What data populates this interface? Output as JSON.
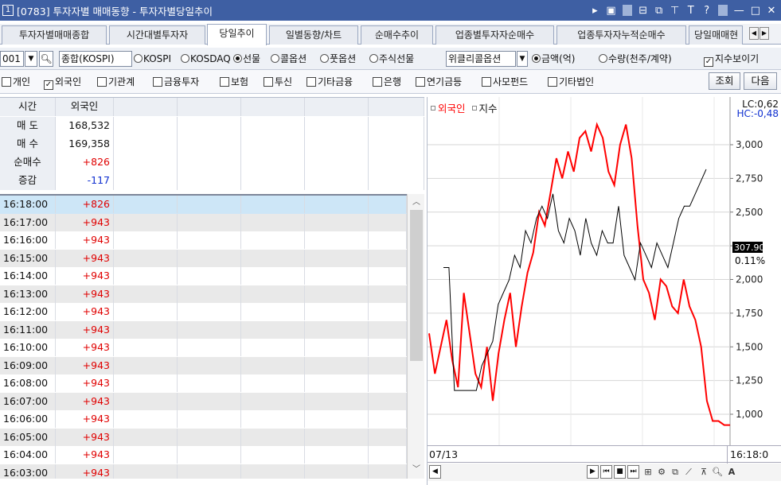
{
  "window": {
    "number": "1",
    "title": "[0783] 투자자별 매매동향 - 투자자별당일추이",
    "controls": [
      "▸",
      "▣",
      "⊟",
      "⧉",
      "⊤",
      "T",
      "?",
      "—",
      "□",
      "✕"
    ]
  },
  "tabs": [
    {
      "label": "투자자별매매종합",
      "active": false
    },
    {
      "label": "시간대별투자자",
      "active": false
    },
    {
      "label": "당일추이",
      "active": true
    },
    {
      "label": "일별동향/차트",
      "active": false
    },
    {
      "label": "순매수추이",
      "active": false
    },
    {
      "label": "업종별투자자순매수",
      "active": false
    },
    {
      "label": "업종투자자누적순매수",
      "active": false
    },
    {
      "label": "당일매매현",
      "active": false
    }
  ],
  "options": {
    "code": "001",
    "market_field": "종합(KOSPI)",
    "radios_market": [
      {
        "label": "KOSPI",
        "on": false
      },
      {
        "label": "KOSDAQ",
        "on": false
      },
      {
        "label": "선물",
        "on": true
      },
      {
        "label": "콜옵션",
        "on": false
      },
      {
        "label": "풋옵션",
        "on": false
      },
      {
        "label": "주식선물",
        "on": false
      }
    ],
    "weekly_field": "위클리콜옵션",
    "radios_unit": [
      {
        "label": "금액(억)",
        "on": true
      },
      {
        "label": "수량(천주/계약)",
        "on": false
      }
    ],
    "show_index_label": "지수보이기",
    "show_index_checked": true
  },
  "investors": [
    {
      "label": "개인",
      "checked": false
    },
    {
      "label": "외국인",
      "checked": true
    },
    {
      "label": "기관계",
      "checked": false
    },
    {
      "label": "금융투자",
      "checked": false
    },
    {
      "label": "보험",
      "checked": false
    },
    {
      "label": "투신",
      "checked": false
    },
    {
      "label": "기타금융",
      "checked": false
    },
    {
      "label": "은행",
      "checked": false
    },
    {
      "label": "연기금등",
      "checked": false
    },
    {
      "label": "사모펀드",
      "checked": false
    },
    {
      "label": "기타법인",
      "checked": false
    }
  ],
  "buttons": {
    "query": "조회",
    "next": "다음"
  },
  "summary": {
    "header": [
      "시간",
      "외국인"
    ],
    "rows": [
      {
        "label": "매 도",
        "value": "168,532",
        "color": "#111111"
      },
      {
        "label": "매 수",
        "value": "169,358",
        "color": "#111111"
      },
      {
        "label": "순매수",
        "value": "+826",
        "color": "#e00000"
      },
      {
        "label": "증감",
        "value": "-117",
        "color": "#1030d0"
      }
    ]
  },
  "timeseries": [
    {
      "time": "16:18:00",
      "value": "+826"
    },
    {
      "time": "16:17:00",
      "value": "+943"
    },
    {
      "time": "16:16:00",
      "value": "+943"
    },
    {
      "time": "16:15:00",
      "value": "+943"
    },
    {
      "time": "16:14:00",
      "value": "+943"
    },
    {
      "time": "16:13:00",
      "value": "+943"
    },
    {
      "time": "16:12:00",
      "value": "+943"
    },
    {
      "time": "16:11:00",
      "value": "+943"
    },
    {
      "time": "16:10:00",
      "value": "+943"
    },
    {
      "time": "16:09:00",
      "value": "+943"
    },
    {
      "time": "16:08:00",
      "value": "+943"
    },
    {
      "time": "16:07:00",
      "value": "+943"
    },
    {
      "time": "16:06:00",
      "value": "+943"
    },
    {
      "time": "16:05:00",
      "value": "+943"
    },
    {
      "time": "16:04:00",
      "value": "+943"
    },
    {
      "time": "16:03:00",
      "value": "+943"
    }
  ],
  "chart": {
    "legend_foreign": "외국인",
    "legend_index": "지수",
    "lc_label": "LC:0,62",
    "hc_label": "HC:-0,48",
    "price_tag_value": "307.90",
    "price_tag_pct": "0.11%",
    "date_start": "07/13",
    "time_end": "16:18:0",
    "colors": {
      "foreign": "#ff0000",
      "index": "#000000",
      "hc": "#1030d0"
    }
  },
  "chart_data": {
    "type": "line",
    "y_axis_right": {
      "ticks": [
        "3,000",
        "2,750",
        "2,500",
        "2,250",
        "2,000",
        "1,750",
        "1,500",
        "1,250",
        "1,000"
      ]
    },
    "series": [
      {
        "name": "외국인",
        "values": [
          1600,
          1300,
          1500,
          1700,
          1400,
          1200,
          1900,
          1600,
          1300,
          1200,
          1500,
          1100,
          1450,
          1700,
          1900,
          1500,
          1800,
          2050,
          2200,
          2500,
          2400,
          2650,
          2900,
          2750,
          2950,
          2800,
          3050,
          3100,
          2950,
          3150,
          3050,
          2800,
          2700,
          3000,
          3150,
          2900,
          2400,
          2000,
          1900,
          1700,
          2000,
          1950,
          1800,
          1750,
          2000,
          1800,
          1700,
          1500,
          1100,
          950,
          950,
          920,
          920
        ]
      },
      {
        "name": "지수",
        "values": [
          300,
          300,
          290,
          290,
          290,
          290,
          290,
          292,
          293,
          294,
          297,
          298,
          299,
          301,
          300,
          303,
          302,
          304,
          305,
          304,
          306,
          303,
          302,
          304,
          303,
          301,
          304,
          302,
          301,
          303,
          302,
          302,
          305,
          301,
          300,
          299,
          302,
          301,
          300,
          302,
          301,
          300,
          302,
          304,
          305,
          305,
          306,
          307,
          308
        ]
      }
    ]
  }
}
